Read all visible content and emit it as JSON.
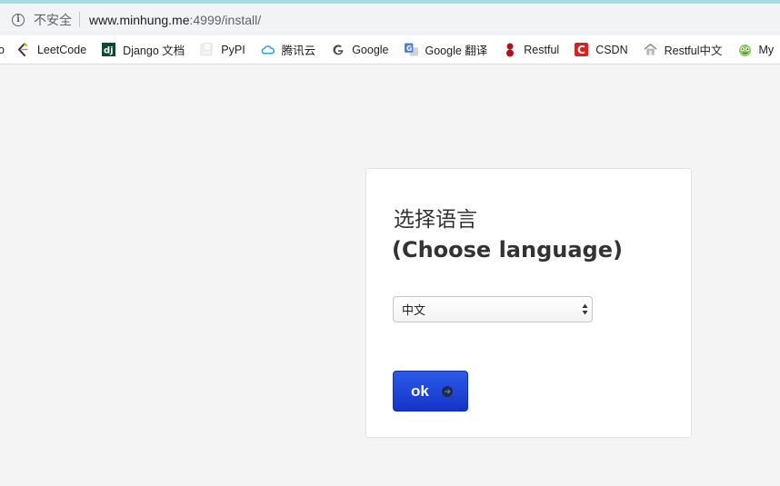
{
  "browser": {
    "security_label": "不安全",
    "url_host": "www.minhung.me",
    "url_rest": ":4999/install/"
  },
  "bookmarks": [
    {
      "label": "o",
      "icon": "partial-bookmark-icon"
    },
    {
      "label": "LeetCode",
      "icon": "leetcode-icon"
    },
    {
      "label": "Django 文档",
      "icon": "django-icon"
    },
    {
      "label": "PyPI",
      "icon": "pypi-icon"
    },
    {
      "label": "腾讯云",
      "icon": "tencent-cloud-icon"
    },
    {
      "label": "Google",
      "icon": "google-icon"
    },
    {
      "label": "Google 翻译",
      "icon": "google-translate-icon"
    },
    {
      "label": "Restful",
      "icon": "restful-icon"
    },
    {
      "label": "CSDN",
      "icon": "csdn-icon"
    },
    {
      "label": "Restful中文",
      "icon": "house-icon"
    },
    {
      "label": "My",
      "icon": "frog-icon"
    }
  ],
  "install": {
    "title_zh": "选择语言",
    "title_en": "(Choose language)",
    "language_selected": "中文",
    "ok_label": "ok"
  },
  "colors": {
    "accent_bar": "#a3dfe0",
    "button_blue": "#1f46d8",
    "page_background": "#f4f4f4"
  }
}
